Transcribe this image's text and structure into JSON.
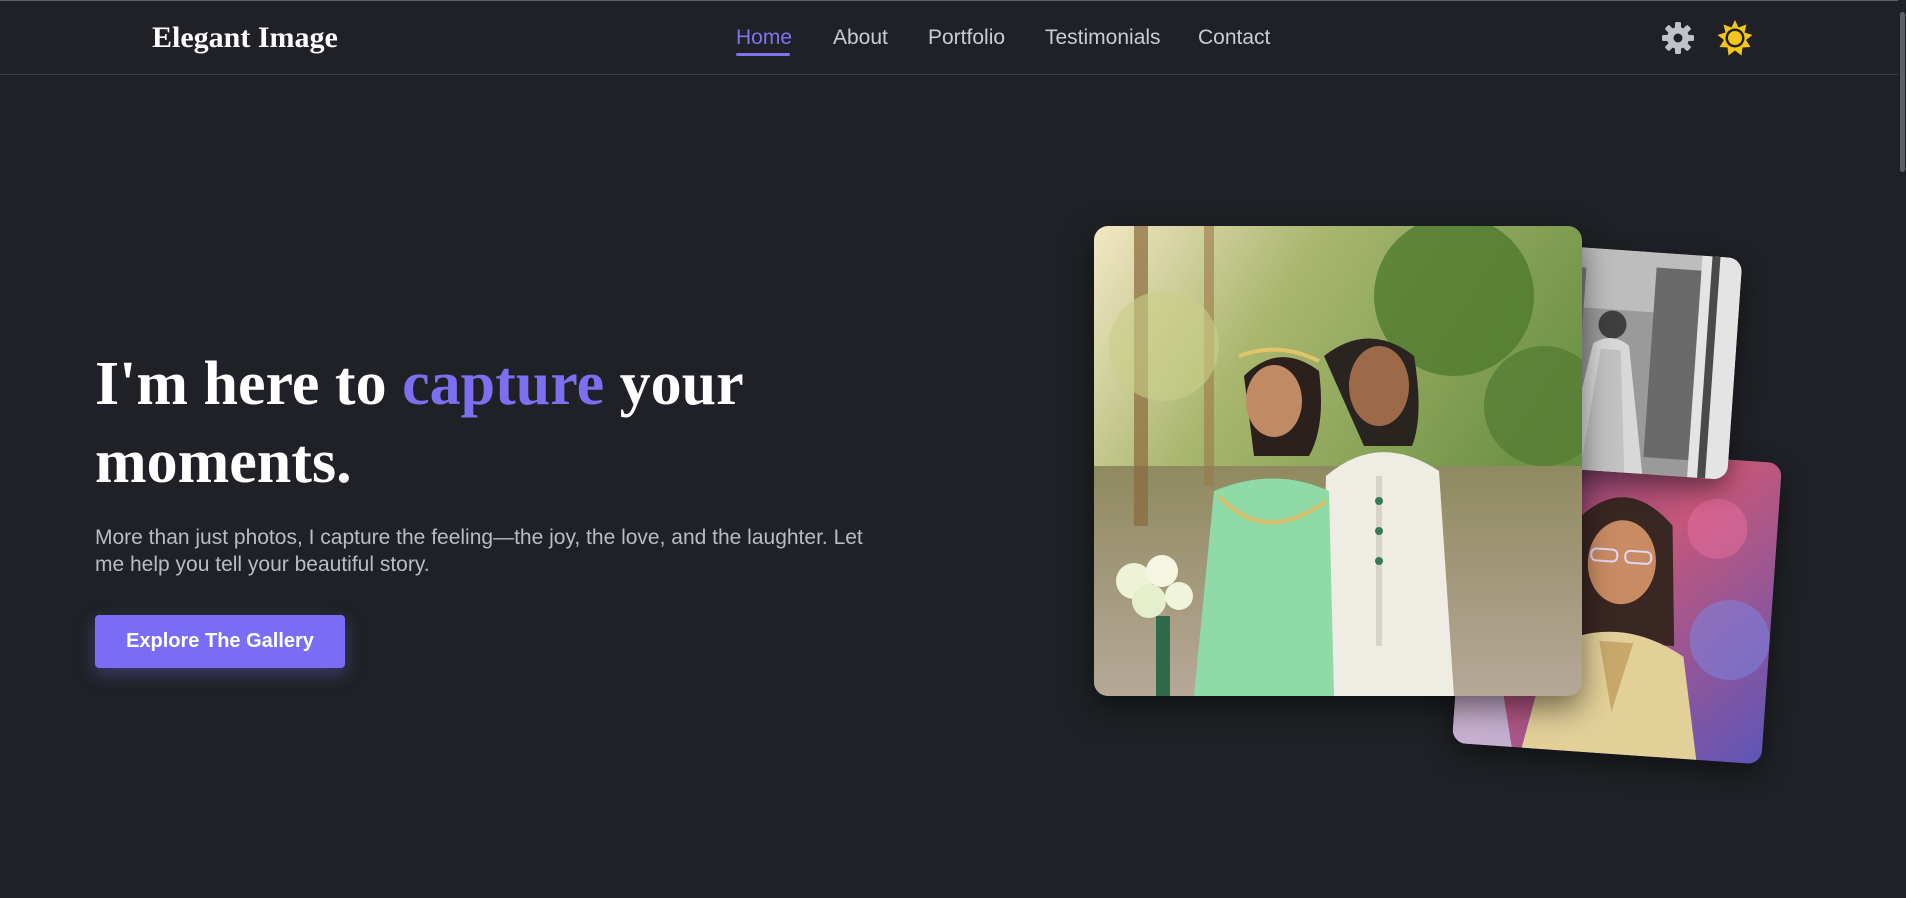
{
  "header": {
    "logo": "Elegant Image",
    "nav": [
      {
        "label": "Home",
        "active": true
      },
      {
        "label": "About"
      },
      {
        "label": "Portfolio"
      },
      {
        "label": "Testimonials"
      },
      {
        "label": "Contact"
      }
    ],
    "icons": [
      "gear-icon",
      "sun-icon"
    ]
  },
  "hero": {
    "headline_before": "I'm here to ",
    "headline_accent": "capture",
    "headline_after": " your moments.",
    "subtext": "More than just photos, I capture the feeling—the joy, the love, and the laughter. Let me help you tell your beautiful story.",
    "cta_label": "Explore The Gallery"
  },
  "colors": {
    "background": "#1f2126",
    "accent": "#7a6cf4",
    "sun": "#f5c518"
  }
}
